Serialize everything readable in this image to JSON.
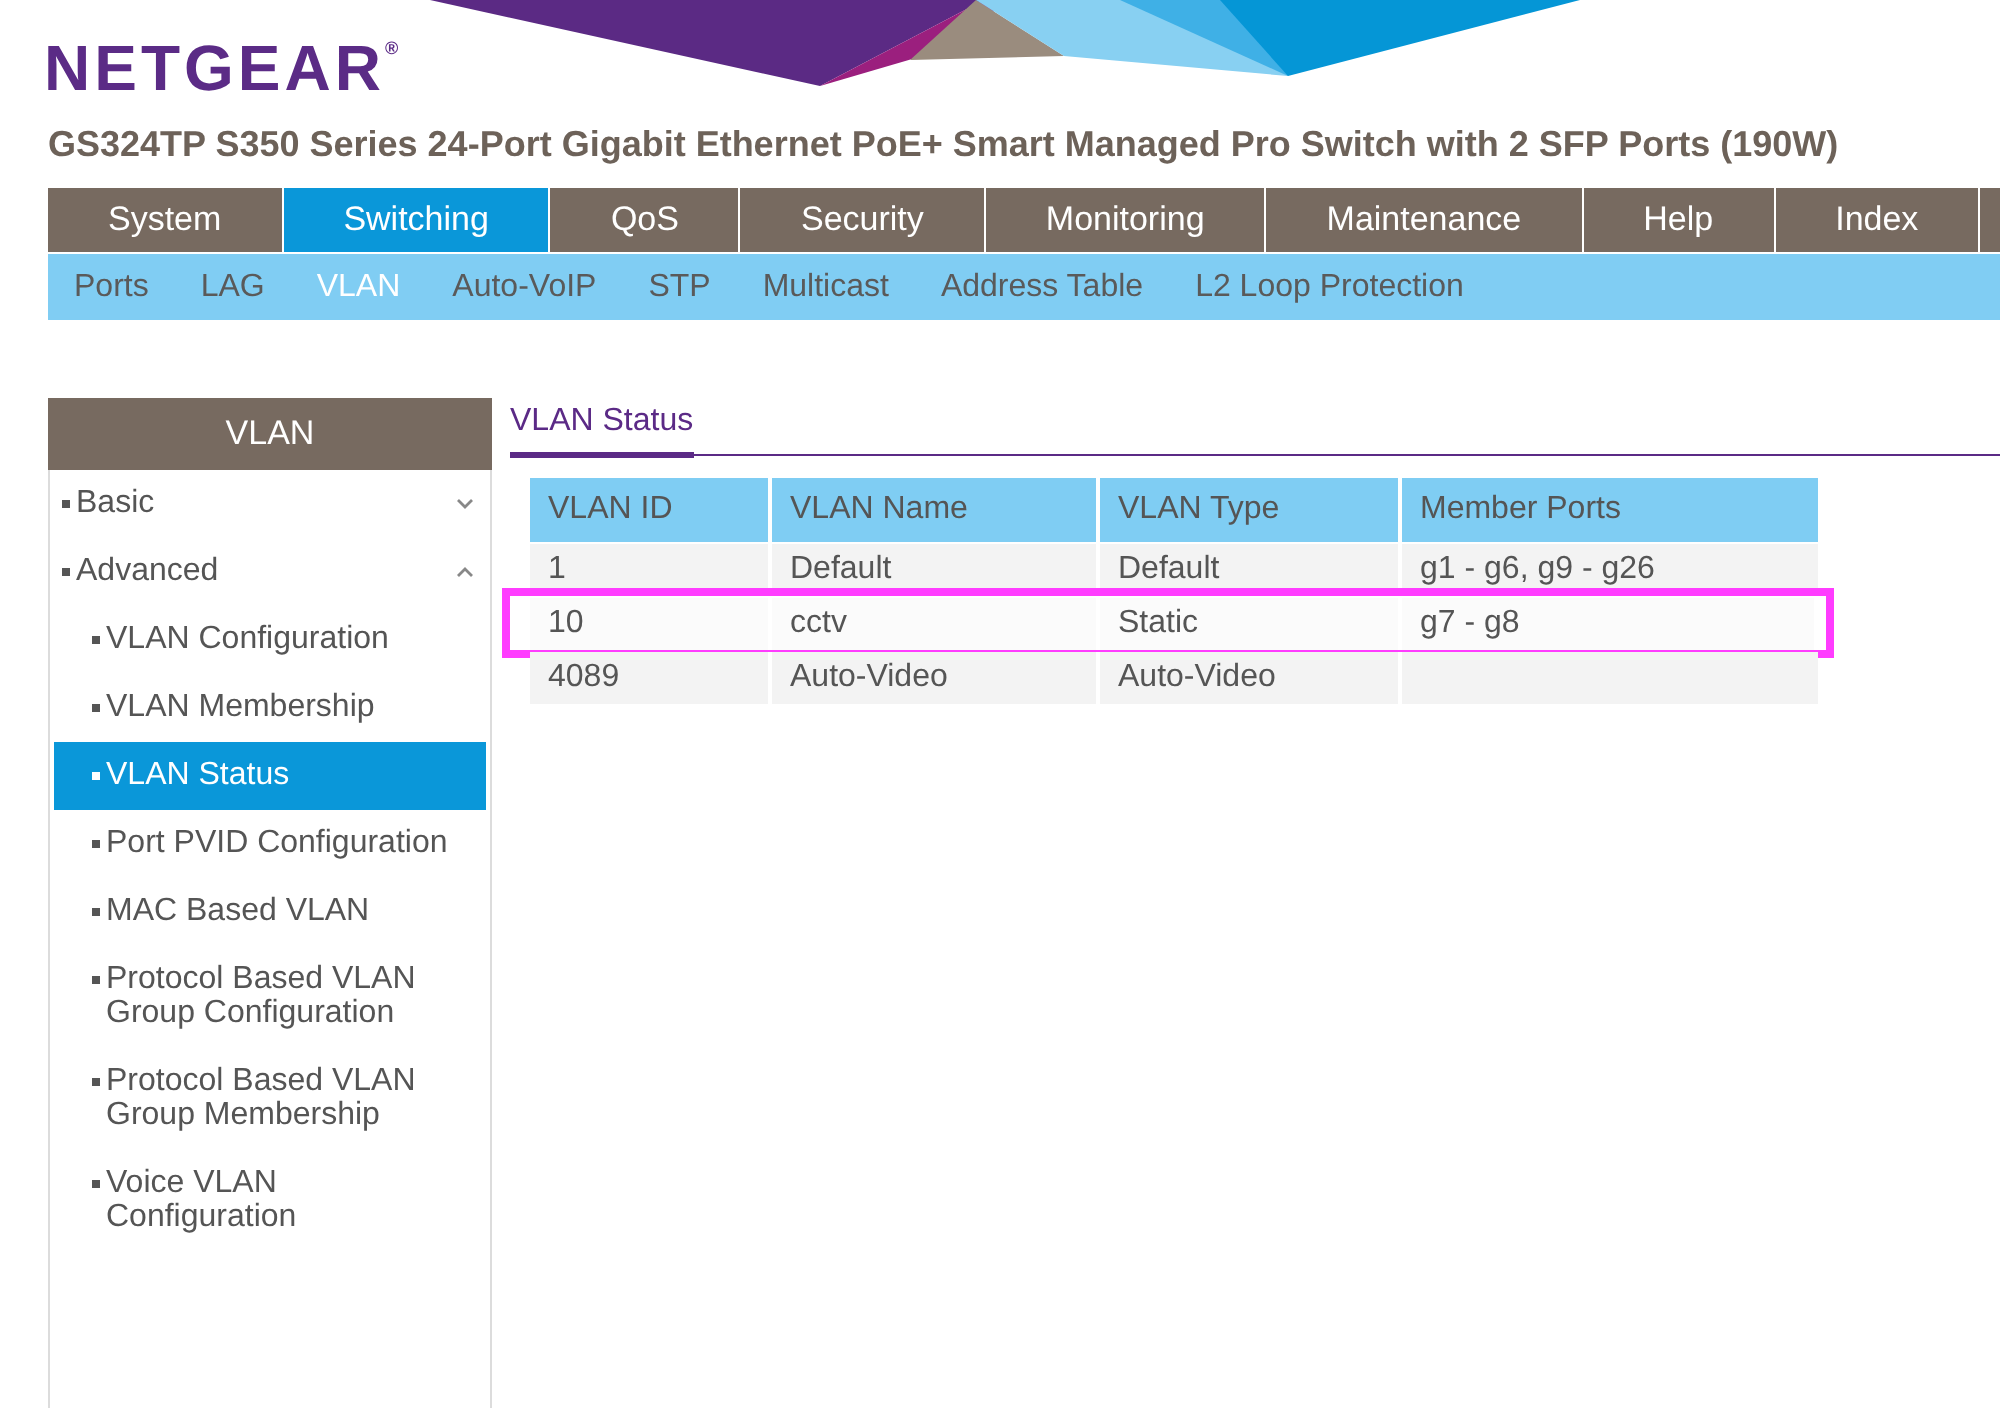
{
  "header": {
    "logo": "NETGEAR$^{®}$",
    "product_title": "GS324TP S350 Series 24-Port Gigabit Ethernet PoE+ Smart Managed Pro Switch with 2 SFP Ports (190W)"
  },
  "main_menu": [
    {
      "label": "System",
      "selected": false
    },
    {
      "label": "Switching",
      "selected": true
    },
    {
      "label": "QoS",
      "selected": false
    },
    {
      "label": "Security",
      "selected": false
    },
    {
      "label": "Monitoring",
      "selected": false
    },
    {
      "label": "Maintenance",
      "selected": false
    },
    {
      "label": "Help",
      "selected": false
    },
    {
      "label": "Index",
      "selected": false
    }
  ],
  "sub_menu": [
    {
      "label": "Ports",
      "selected": false
    },
    {
      "label": "LAG",
      "selected": false
    },
    {
      "label": "VLAN",
      "selected": true
    },
    {
      "label": "Auto-VoIP",
      "selected": false
    },
    {
      "label": "STP",
      "selected": false
    },
    {
      "label": "Multicast",
      "selected": false
    },
    {
      "label": "Address Table",
      "selected": false
    },
    {
      "label": "L2 Loop Protection",
      "selected": false
    }
  ],
  "sidebar": {
    "title": "VLAN",
    "items": [
      {
        "label": "Basic",
        "expanded": false
      },
      {
        "label": "Advanced",
        "expanded": true,
        "children": [
          {
            "label": "VLAN Configuration",
            "selected": false
          },
          {
            "label": "VLAN Membership",
            "selected": false
          },
          {
            "label": "VLAN Status",
            "selected": true
          },
          {
            "label": "Port PVID Configuration",
            "selected": false
          },
          {
            "label": "MAC Based VLAN",
            "selected": false
          },
          {
            "label": "Protocol Based VLAN Group Configuration",
            "selected": false
          },
          {
            "label": "Protocol Based VLAN Group Membership",
            "selected": false
          },
          {
            "label": "Voice VLAN Configuration",
            "selected": false
          }
        ]
      }
    ]
  },
  "panel": {
    "title": "VLAN Status",
    "table": {
      "columns": [
        "VLAN ID",
        "VLAN Name",
        "VLAN Type",
        "Member Ports"
      ],
      "rows": [
        {
          "cells": [
            "1",
            "Default",
            "Default",
            "g1 - g6, g9 - g26"
          ],
          "highlighted": false
        },
        {
          "cells": [
            "10",
            "cctv",
            "Static",
            "g7 - g8"
          ],
          "highlighted": true
        },
        {
          "cells": [
            "4089",
            "Auto-Video",
            "Auto-Video"
          ],
          "highlighted": false
        }
      ]
    }
  }
}
